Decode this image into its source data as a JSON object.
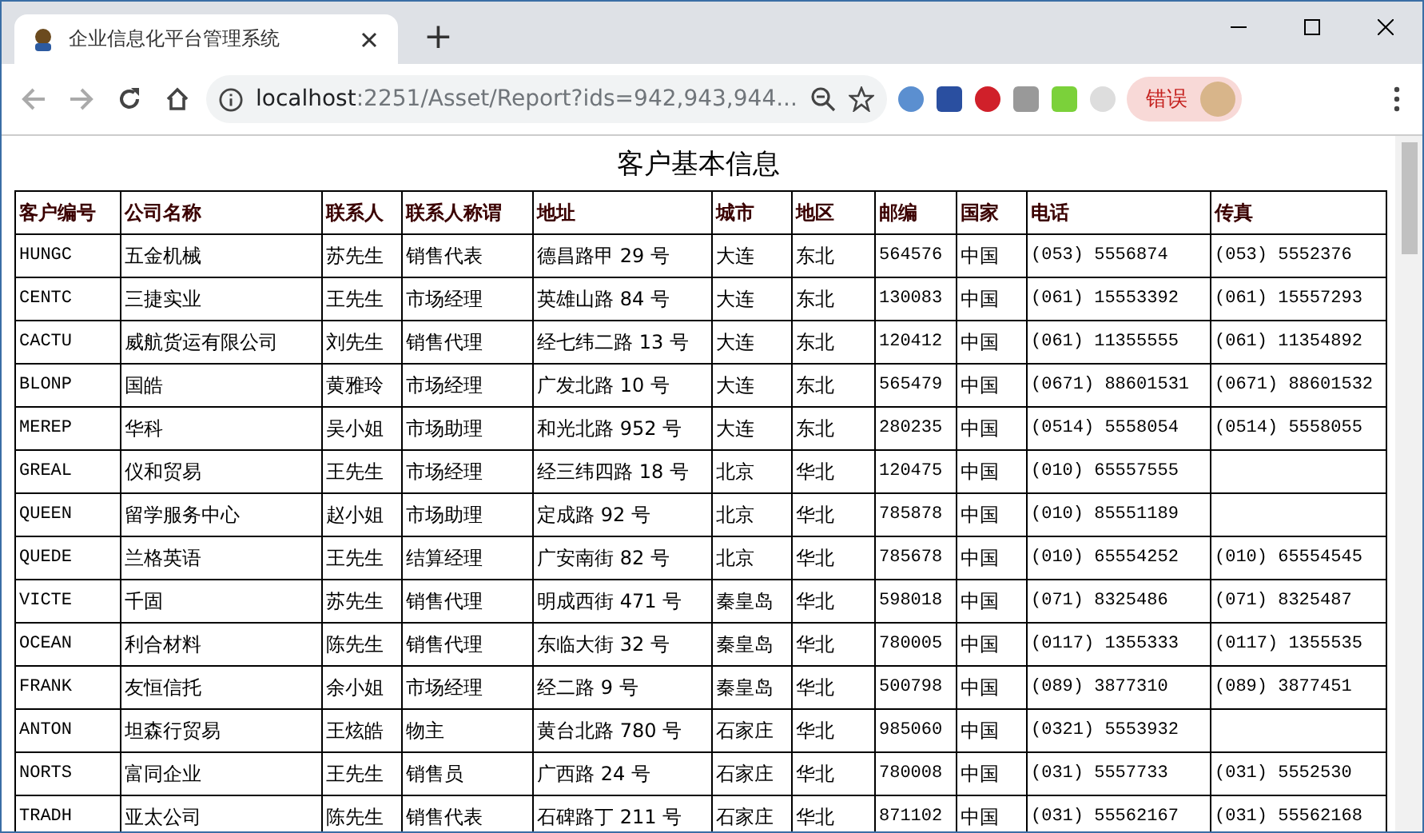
{
  "browser": {
    "tab_title": "企业信息化平台管理系统",
    "new_tab": "+",
    "url_host": "localhost",
    "url_rest": ":2251/Asset/Report?ids=942,943,944...",
    "profile_label": "错误"
  },
  "page": {
    "title": "客户基本信息"
  },
  "table": {
    "columns": [
      "客户编号",
      "公司名称",
      "联系人",
      "联系人称谓",
      "地址",
      "城市",
      "地区",
      "邮编",
      "国家",
      "电话",
      "传真"
    ],
    "rows": [
      [
        "HUNGC",
        "五金机械",
        "苏先生",
        "销售代表",
        "德昌路甲 29 号",
        "大连",
        "东北",
        "564576",
        "中国",
        "(053) 5556874",
        "(053) 5552376"
      ],
      [
        "CENTC",
        "三捷实业",
        "王先生",
        "市场经理",
        "英雄山路 84 号",
        "大连",
        "东北",
        "130083",
        "中国",
        "(061) 15553392",
        "(061) 15557293"
      ],
      [
        "CACTU",
        "威航货运有限公司",
        "刘先生",
        "销售代理",
        "经七纬二路 13 号",
        "大连",
        "东北",
        "120412",
        "中国",
        "(061) 11355555",
        "(061) 11354892"
      ],
      [
        "BLONP",
        "国皓",
        "黄雅玲",
        "市场经理",
        "广发北路 10 号",
        "大连",
        "东北",
        "565479",
        "中国",
        "(0671) 88601531",
        "(0671) 88601532"
      ],
      [
        "MEREP",
        "华科",
        "吴小姐",
        "市场助理",
        "和光北路 952 号",
        "大连",
        "东北",
        "280235",
        "中国",
        "(0514) 5558054",
        "(0514) 5558055"
      ],
      [
        "GREAL",
        "仪和贸易",
        "王先生",
        "市场经理",
        "经三纬四路 18 号",
        "北京",
        "华北",
        "120475",
        "中国",
        "(010) 65557555",
        ""
      ],
      [
        "QUEEN",
        "留学服务中心",
        "赵小姐",
        "市场助理",
        "定成路 92 号",
        "北京",
        "华北",
        "785878",
        "中国",
        "(010) 85551189",
        ""
      ],
      [
        "QUEDE",
        "兰格英语",
        "王先生",
        "结算经理",
        "广安南街 82 号",
        "北京",
        "华北",
        "785678",
        "中国",
        "(010) 65554252",
        "(010) 65554545"
      ],
      [
        "VICTE",
        "千固",
        "苏先生",
        "销售代理",
        "明成西街 471 号",
        "秦皇岛",
        "华北",
        "598018",
        "中国",
        "(071) 8325486",
        "(071) 8325487"
      ],
      [
        "OCEAN",
        "利合材料",
        "陈先生",
        "销售代理",
        "东临大街 32 号",
        "秦皇岛",
        "华北",
        "780005",
        "中国",
        "(0117) 1355333",
        "(0117) 1355535"
      ],
      [
        "FRANK",
        "友恒信托",
        "余小姐",
        "市场经理",
        "经二路 9 号",
        "秦皇岛",
        "华北",
        "500798",
        "中国",
        "(089) 3877310",
        "(089) 3877451"
      ],
      [
        "ANTON",
        "坦森行贸易",
        "王炫皓",
        "物主",
        "黄台北路 780 号",
        "石家庄",
        "华北",
        "985060",
        "中国",
        "(0321) 5553932",
        ""
      ],
      [
        "NORTS",
        "富同企业",
        "王先生",
        "销售员",
        "广西路 24 号",
        "石家庄",
        "华北",
        "780008",
        "中国",
        "(031) 5557733",
        "(031) 5552530"
      ],
      [
        "TRADH",
        "亚太公司",
        "陈先生",
        "销售代表",
        "石碑路丁 211 号",
        "石家庄",
        "华北",
        "871102",
        "中国",
        "(031) 55562167",
        "(031) 55562168"
      ]
    ]
  }
}
